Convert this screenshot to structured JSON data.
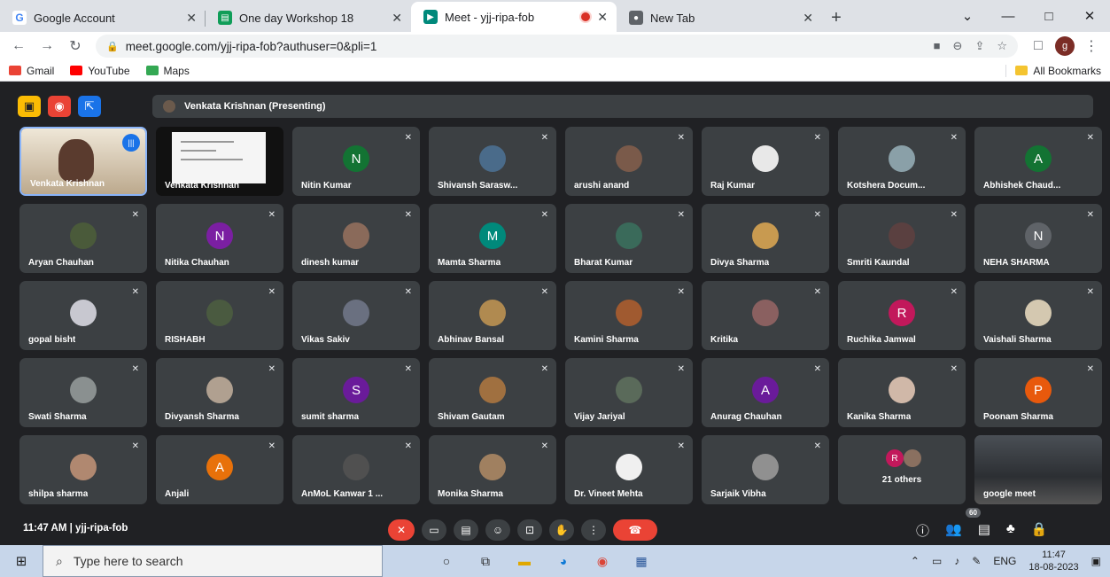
{
  "tabs": [
    {
      "title": "Google Account",
      "favicon": "G",
      "favicon_color": "#4285f4"
    },
    {
      "title": "One day Workshop 18",
      "favicon": "▤",
      "favicon_color": "#0f9d58"
    },
    {
      "title": "Meet - yjj-ripa-fob",
      "favicon": "▶",
      "favicon_color": "#00897b"
    },
    {
      "title": "New Tab",
      "favicon": "●",
      "favicon_color": "#5f6368"
    }
  ],
  "window_controls": {
    "min": "—",
    "max": "□",
    "close": "✕",
    "collapse": "⌄"
  },
  "toolbar": {
    "url": "meet.google.com/yjj-ripa-fob?authuser=0&pli=1",
    "profile_initial": "g"
  },
  "bookmarks": [
    {
      "label": "Gmail",
      "color": "#ea4335"
    },
    {
      "label": "YouTube",
      "color": "#ff0000"
    },
    {
      "label": "Maps",
      "color": "#34a853"
    }
  ],
  "all_bookmarks_label": "All Bookmarks",
  "presenter_label": "Venkata Krishnan (Presenting)",
  "tiles": [
    {
      "name": "Venkata Krishnan",
      "type": "video"
    },
    {
      "name": "Venkata Krishnan",
      "type": "screen"
    },
    {
      "name": "Nitin Kumar",
      "initial": "N",
      "color": "#137333"
    },
    {
      "name": "Shivansh Sarasw...",
      "color": "#4a6b8a"
    },
    {
      "name": "arushi anand",
      "color": "#7a5a4a"
    },
    {
      "name": "Raj Kumar",
      "color": "#e8e8e8"
    },
    {
      "name": "Kotshera Docum...",
      "color": "#8aa0a8"
    },
    {
      "name": "Abhishek Chaud...",
      "initial": "A",
      "color": "#137333"
    },
    {
      "name": "Aryan Chauhan",
      "color": "#4a5a3a"
    },
    {
      "name": "Nitika Chauhan",
      "initial": "N",
      "color": "#7b1fa2"
    },
    {
      "name": "dinesh kumar",
      "color": "#8a6a5a"
    },
    {
      "name": "Mamta Sharma",
      "initial": "M",
      "color": "#00897b"
    },
    {
      "name": "Bharat Kumar",
      "color": "#3a6a5a"
    },
    {
      "name": "Divya Sharma",
      "color": "#c89a50"
    },
    {
      "name": "Smriti Kaundal",
      "color": "#5a4040"
    },
    {
      "name": "NEHA SHARMA",
      "initial": "N",
      "color": "#5f6368"
    },
    {
      "name": "gopal bisht",
      "color": "#c8c8d0"
    },
    {
      "name": "RISHABH",
      "color": "#4a5a40"
    },
    {
      "name": "Vikas Sakiv",
      "color": "#6a7080"
    },
    {
      "name": "Abhinav Bansal",
      "color": "#b08a50"
    },
    {
      "name": "Kamini Sharma",
      "color": "#a05a30"
    },
    {
      "name": "Kritika",
      "color": "#8a6060"
    },
    {
      "name": "Ruchika Jamwal",
      "initial": "R",
      "color": "#c2185b"
    },
    {
      "name": "Vaishali Sharma",
      "color": "#d4c8b0"
    },
    {
      "name": "Swati Sharma",
      "color": "#8a9090"
    },
    {
      "name": "Divyansh Sharma",
      "color": "#b0a090"
    },
    {
      "name": "sumit sharma",
      "initial": "S",
      "color": "#6a1b9a"
    },
    {
      "name": "Shivam Gautam",
      "color": "#a07040"
    },
    {
      "name": "Vijay Jariyal",
      "color": "#5a6a5a"
    },
    {
      "name": "Anurag Chauhan",
      "initial": "A",
      "color": "#6a1b9a"
    },
    {
      "name": "Kanika Sharma",
      "color": "#d0b8a8"
    },
    {
      "name": "Poonam Sharma",
      "initial": "P",
      "color": "#e8590c"
    },
    {
      "name": "shilpa sharma",
      "color": "#b08870"
    },
    {
      "name": "Anjali",
      "initial": "A",
      "color": "#e8710a"
    },
    {
      "name": "AnMoL Kanwar 1 ...",
      "color": "#505050"
    },
    {
      "name": "Monika Sharma",
      "color": "#a08060"
    },
    {
      "name": "Dr. Vineet Mehta",
      "color": "#f0f0f0"
    },
    {
      "name": "Sarjaik Vibha",
      "color": "#909090"
    },
    {
      "name": "21 others",
      "type": "others"
    },
    {
      "name": "google meet",
      "type": "gm"
    }
  ],
  "others_initial": "R",
  "bottom": {
    "time": "11:47 AM",
    "code": "yjj-ripa-fob",
    "participant_count": "60"
  },
  "taskbar": {
    "search_placeholder": "Type here to search",
    "lang": "ENG",
    "time": "11:47",
    "date": "18-08-2023"
  }
}
